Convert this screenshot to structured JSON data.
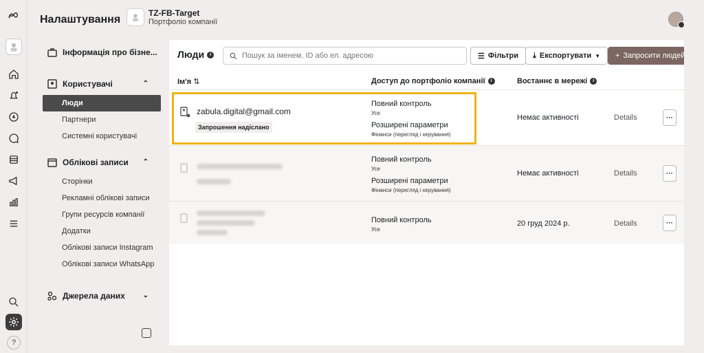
{
  "header": {
    "title": "Налаштування",
    "portfolio_name": "TZ-FB-Target",
    "portfolio_sub": "Портфоліо компанії"
  },
  "sidebar": {
    "business_info": "Інформація про бізне...",
    "users_section": "Користувачі",
    "users_items": [
      "Люди",
      "Партнери",
      "Системні користувачі"
    ],
    "accounts_section": "Облікові записи",
    "accounts_items": [
      "Сторінки",
      "Рекламні облікові записи",
      "Групи ресурсів компанії",
      "Додатки",
      "Облікові записи Instagram",
      "Облікові записи WhatsApp"
    ],
    "data_sources": "Джерела даних"
  },
  "main": {
    "title": "Люди",
    "search_placeholder": "Пошук за іменем, ID або ел. адресою",
    "filters_label": "Фільтри",
    "export_label": "Експортувати",
    "invite_label": "Запросити людей",
    "columns": {
      "name": "Ім'я",
      "access": "Доступ до портфоліо компанії",
      "last_online": "Востаннє в мережі"
    },
    "rows": [
      {
        "email": "zabula.digital@gmail.com",
        "status": "Запрошення надіслано",
        "access1_title": "Повний контроль",
        "access1_sub": "Усе",
        "access2_title": "Розширені параметри",
        "access2_sub": "Фінанси (перегляд і керування)",
        "last_online": "Немає активності",
        "details": "Details"
      },
      {
        "access1_title": "Повний контроль",
        "access1_sub": "Усе",
        "access2_title": "Розширені параметри",
        "access2_sub": "Фінанси (перегляд і керування)",
        "last_online": "Немає активності",
        "details": "Details"
      },
      {
        "access1_title": "Повний контроль",
        "access1_sub": "Усе",
        "last_online": "20 груд 2024 р.",
        "details": "Details"
      }
    ]
  }
}
